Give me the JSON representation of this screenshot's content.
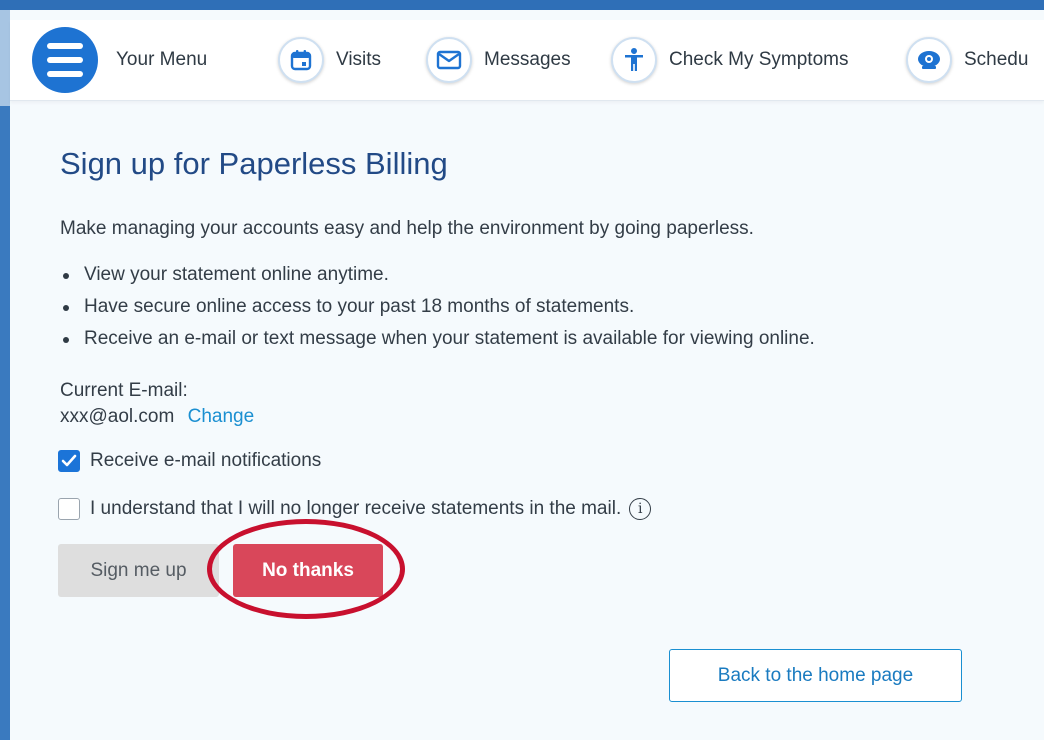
{
  "nav": {
    "menu_label": "Your Menu",
    "visits_label": "Visits",
    "messages_label": "Messages",
    "symptoms_label": "Check My Symptoms",
    "schedule_label": "Schedu"
  },
  "page": {
    "title": "Sign up for Paperless Billing",
    "intro": "Make managing your accounts easy and help the environment by going paperless.",
    "bullets": [
      "View your statement online anytime.",
      "Have secure online access to your past 18 months of statements.",
      "Receive an e-mail or text message when your statement is available for viewing online."
    ]
  },
  "email": {
    "label": "Current E-mail:",
    "value": "xxx@aol.com",
    "change_link": "Change"
  },
  "options": {
    "email_notifications_label": "Receive e-mail notifications",
    "email_notifications_checked": true,
    "no_mail_ack_label": "I understand that I will no longer receive statements in the mail.",
    "no_mail_ack_checked": false
  },
  "buttons": {
    "sign_up": "Sign me up",
    "no_thanks": "No thanks",
    "back_home": "Back to the home page"
  },
  "colors": {
    "brand_blue": "#1e73d2",
    "title_blue": "#224a86",
    "link_blue": "#1a8fd1",
    "danger_red": "#d9475a",
    "annotation_red": "#c8102e"
  }
}
